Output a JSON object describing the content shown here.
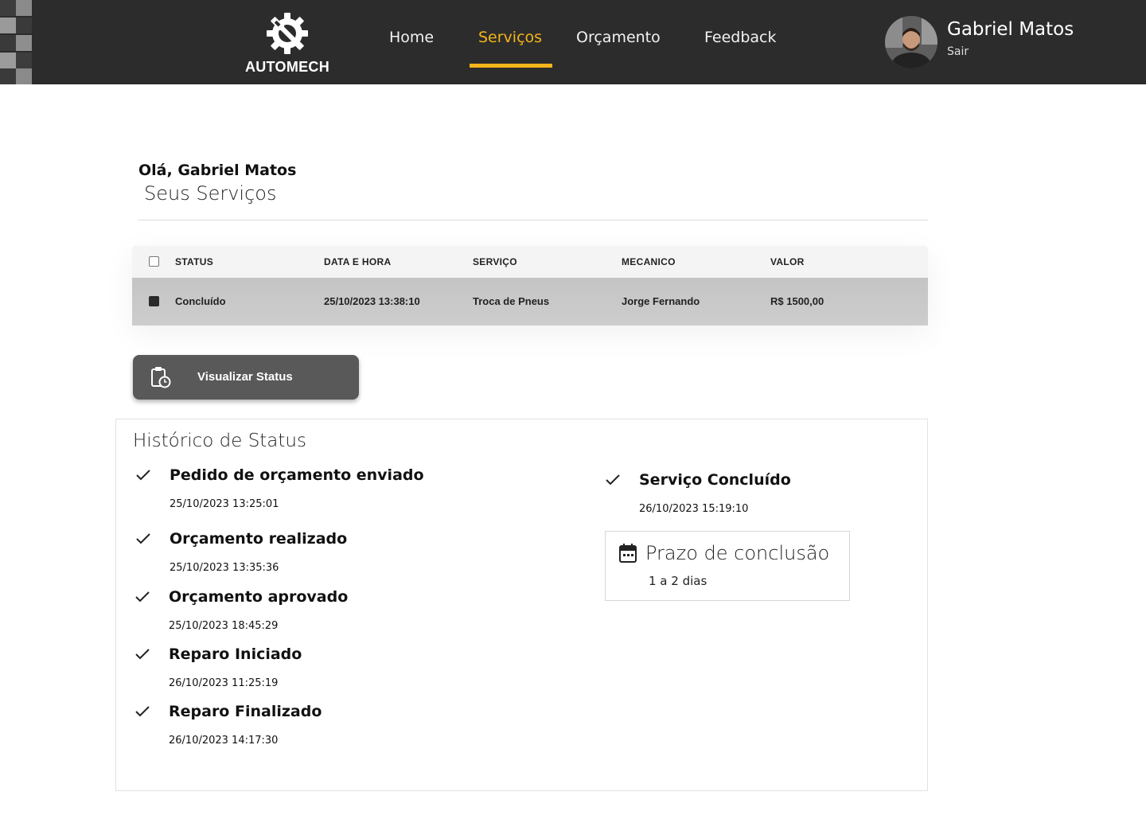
{
  "brand": {
    "name": "AUTOMECH"
  },
  "nav": {
    "items": [
      {
        "label": "Home",
        "active": false
      },
      {
        "label": "Serviços",
        "active": true
      },
      {
        "label": "Orçamento",
        "active": false
      },
      {
        "label": "Feedback",
        "active": false
      }
    ],
    "accent_color": "#f4b41a"
  },
  "user": {
    "name": "Gabriel Matos",
    "logout_label": "Sair"
  },
  "main": {
    "greeting": "Olá, Gabriel Matos",
    "title": "Seus Serviços"
  },
  "table": {
    "columns": [
      "STATUS",
      "DATA E HORA",
      "SERVIÇO",
      "MECANICO",
      "VALOR"
    ],
    "rows": [
      {
        "checked": true,
        "status": "Concluído",
        "datetime": "25/10/2023 13:38:10",
        "service": "Troca de Pneus",
        "mechanic": "Jorge Fernando",
        "value": "R$ 1500,00"
      }
    ]
  },
  "actions": {
    "view_status_label": "Visualizar Status"
  },
  "history": {
    "title": "Histórico de Status",
    "steps": [
      {
        "label": "Pedido de orçamento enviado",
        "time": "25/10/2023 13:25:01"
      },
      {
        "label": "Orçamento realizado",
        "time": "25/10/2023 13:35:36"
      },
      {
        "label": "Orçamento aprovado",
        "time": "25/10/2023 18:45:29"
      },
      {
        "label": "Reparo Iniciado",
        "time": "26/10/2023 11:25:19"
      },
      {
        "label": "Reparo Finalizado",
        "time": "26/10/2023 14:17:30"
      },
      {
        "label": "Serviço Concluído",
        "time": "26/10/2023 15:19:10"
      }
    ],
    "deadline": {
      "title": "Prazo de conclusão",
      "value": "1 a 2 dias"
    }
  }
}
